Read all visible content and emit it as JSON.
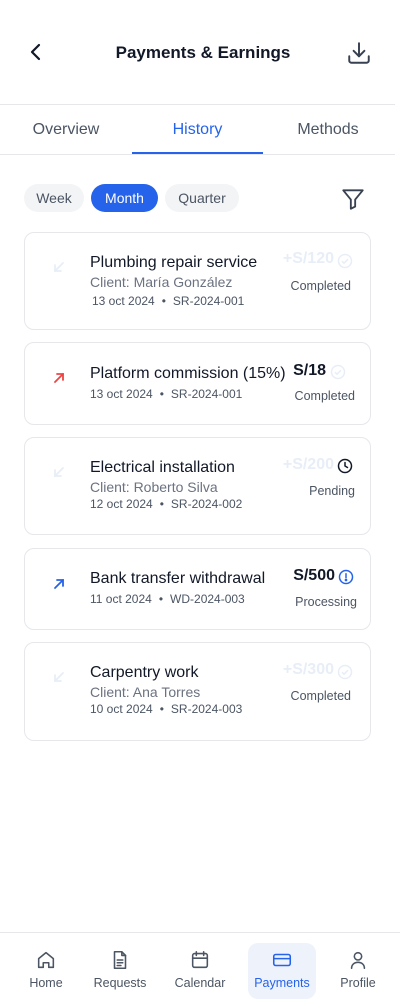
{
  "header": {
    "title": "Payments & Earnings"
  },
  "tabs": [
    {
      "label": "Overview",
      "active": false
    },
    {
      "label": "History",
      "active": true
    },
    {
      "label": "Methods",
      "active": false
    }
  ],
  "periods": [
    {
      "label": "Week",
      "active": false
    },
    {
      "label": "Month",
      "active": true
    },
    {
      "label": "Quarter",
      "active": false
    }
  ],
  "transactions": [
    {
      "title": "Plumbing repair service",
      "client": "Client: María González",
      "date": "13 oct 2024",
      "ref": "SR-2024-001",
      "amount": "+S/120",
      "status": "Completed",
      "direction": "incoming"
    },
    {
      "title": "Platform commission (15%)",
      "client": "",
      "date": "13 oct 2024",
      "ref": "SR-2024-001",
      "amount": "S/18",
      "status": "Completed",
      "direction": "outgoing-fee"
    },
    {
      "title": "Electrical installation",
      "client": "Client: Roberto Silva",
      "date": "12 oct 2024",
      "ref": "SR-2024-002",
      "amount": "+S/200",
      "status": "Pending",
      "direction": "incoming"
    },
    {
      "title": "Bank transfer withdrawal",
      "client": "",
      "date": "11 oct 2024",
      "ref": "WD-2024-003",
      "amount": "S/500",
      "status": "Processing",
      "direction": "outgoing-withdrawal"
    },
    {
      "title": "Carpentry work",
      "client": "Client: Ana Torres",
      "date": "10 oct 2024",
      "ref": "SR-2024-003",
      "amount": "+S/300",
      "status": "Completed",
      "direction": "incoming"
    }
  ],
  "meta_separator": "•",
  "nav": [
    {
      "label": "Home",
      "icon": "home-icon",
      "active": false
    },
    {
      "label": "Requests",
      "icon": "document-icon",
      "active": false
    },
    {
      "label": "Calendar",
      "icon": "calendar-icon",
      "active": false
    },
    {
      "label": "Payments",
      "icon": "credit-card-icon",
      "active": true
    },
    {
      "label": "Profile",
      "icon": "user-icon",
      "active": false
    }
  ],
  "colors": {
    "accent": "#2563eb",
    "incoming_faded": "#e8eef7",
    "fee": "#ef4444",
    "withdrawal": "#2563eb"
  }
}
